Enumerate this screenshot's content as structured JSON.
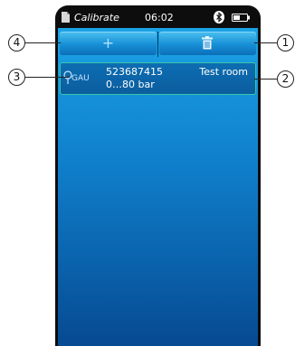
{
  "status_bar": {
    "app_name": "Calibrate",
    "time": "06:02",
    "icons": [
      "document-icon",
      "bluetooth-icon",
      "battery-icon"
    ]
  },
  "toolbar": {
    "add_symbol": "+",
    "icons": [
      "plus-icon",
      "trash-icon"
    ]
  },
  "list": {
    "items": [
      {
        "type": "GAU",
        "serial": "523687415",
        "range": "0…80 bar",
        "location": "Test room",
        "icon": "location-pin-icon"
      }
    ]
  },
  "callouts": [
    "1",
    "2",
    "3",
    "4"
  ],
  "colors": {
    "background_top": "#1ba3e6",
    "background_bottom": "#064a92",
    "selection_border": "#36c7a6"
  }
}
